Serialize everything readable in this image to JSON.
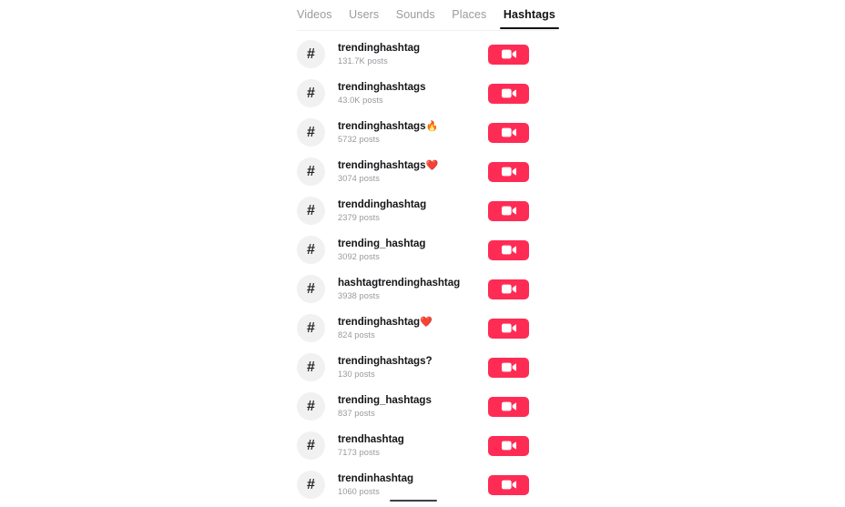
{
  "colors": {
    "accent": "#fe2c55",
    "active_tab": "#131313",
    "inactive_tab": "#9b9b9f",
    "avatar_bg": "#f1f1f2",
    "title": "#16161a",
    "subtitle": "#9a9a9f",
    "background": "#ffffff"
  },
  "tabs": [
    {
      "label": "Videos",
      "active": false
    },
    {
      "label": "Users",
      "active": false
    },
    {
      "label": "Sounds",
      "active": false
    },
    {
      "label": "Places",
      "active": false
    },
    {
      "label": "Hashtags",
      "active": true
    }
  ],
  "hashtag_icon": "#",
  "cta_icon": "video-camera-icon",
  "results": [
    {
      "name": "trendinghashtag",
      "emoji": "",
      "posts": "131.7K posts"
    },
    {
      "name": "trendinghashtags",
      "emoji": "",
      "posts": "43.0K posts"
    },
    {
      "name": "trendinghashtags",
      "emoji": "🔥",
      "posts": "5732 posts"
    },
    {
      "name": "trendinghashtags",
      "emoji": "❤️",
      "posts": "3074 posts"
    },
    {
      "name": "trenddinghashtag",
      "emoji": "",
      "posts": "2379 posts"
    },
    {
      "name": "trending_hashtag",
      "emoji": "",
      "posts": "3092 posts"
    },
    {
      "name": "hashtagtrendinghashtag",
      "emoji": "",
      "posts": "3938 posts"
    },
    {
      "name": "trendinghashtag",
      "emoji": "❤️",
      "posts": "824 posts"
    },
    {
      "name": "trendinghashtags?",
      "emoji": "",
      "posts": "130 posts"
    },
    {
      "name": "trending_hashtags",
      "emoji": "",
      "posts": "837 posts"
    },
    {
      "name": "trendhashtag",
      "emoji": "",
      "posts": "7173 posts"
    },
    {
      "name": "trendinhashtag",
      "emoji": "",
      "posts": "1060 posts"
    }
  ]
}
